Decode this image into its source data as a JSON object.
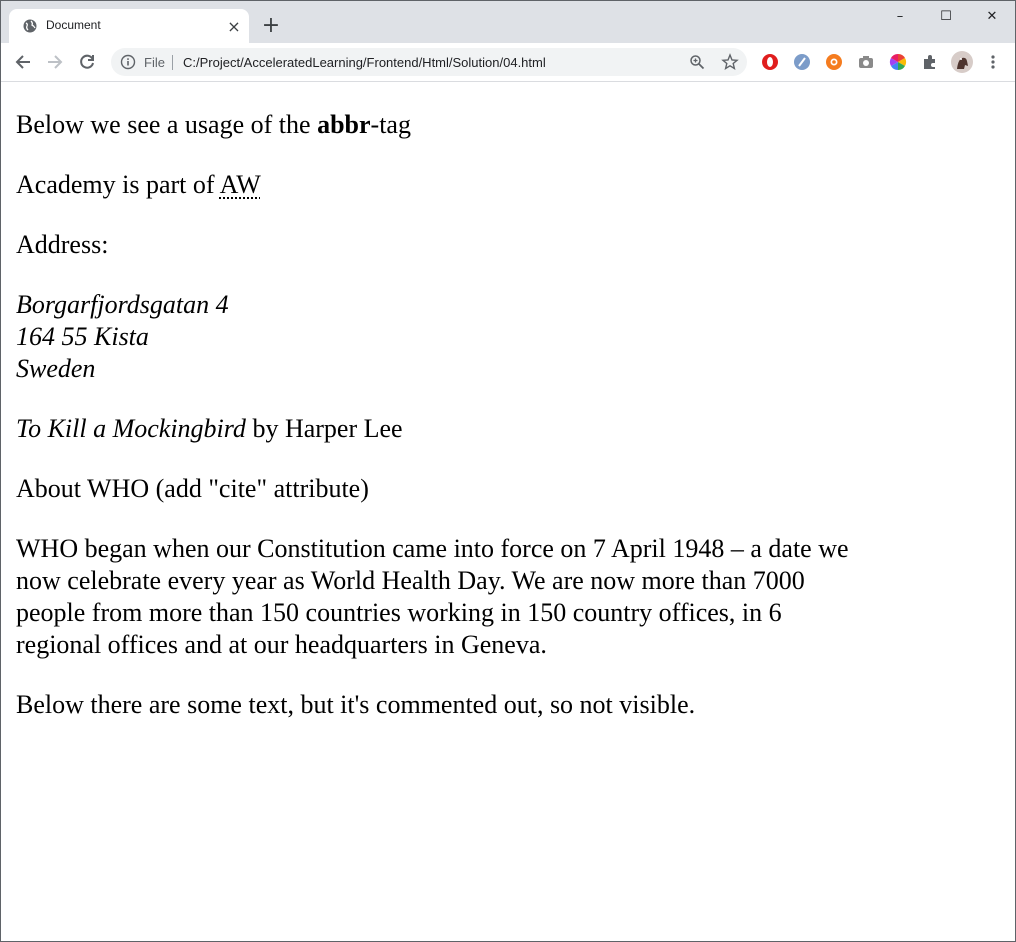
{
  "browser": {
    "tab_title": "Document",
    "new_tab_label": "+",
    "close_tab_label": "×",
    "window_controls": {
      "minimize": "–",
      "maximize": "☐",
      "close": "✕"
    },
    "address_bar": {
      "scheme_label": "File",
      "url": "C:/Project/AcceleratedLearning/Frontend/Html/Solution/04.html"
    },
    "extensions": [
      "opera-icon",
      "tampermonkey-icon",
      "orange-extension-icon",
      "camera-icon",
      "color-wheel-icon",
      "puzzle-icon",
      "profile-avatar"
    ]
  },
  "page": {
    "abbr_intro": {
      "before": "Below we see a usage of the ",
      "bold": "abbr",
      "after": "-tag"
    },
    "academy": {
      "before": "Academy is part of ",
      "abbr": "AW"
    },
    "address_label": "Address:",
    "address_lines": [
      "Borgarfjordsgatan 4",
      "164 55 Kista",
      "Sweden"
    ],
    "book": {
      "title": "To Kill a Mockingbird",
      "rest": " by Harper Lee"
    },
    "about_who": "About WHO (add \"cite\" attribute)",
    "blockquote": "WHO began when our Constitution came into force on 7 April 1948 – a date we now celebrate every year as World Health Day. We are now more than 7000 people from more than 150 countries working in 150 country offices, in 6 regional offices and at our headquarters in Geneva.",
    "comment_note": "Below there are some text, but it's commented out, so not visible."
  },
  "colors": {
    "tabstrip_bg": "#dee1e6",
    "omnibox_bg": "#f1f3f4",
    "text": "#000000"
  }
}
